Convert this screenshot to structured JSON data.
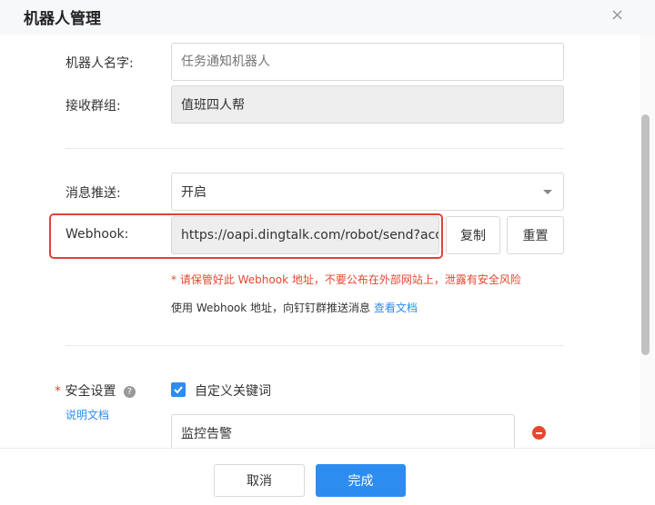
{
  "dialog": {
    "title": "机器人管理",
    "close_icon": "×"
  },
  "form": {
    "robot_name": {
      "label": "机器人名字:",
      "placeholder": "任务通知机器人"
    },
    "receive_group": {
      "label": "接收群组:",
      "value": "值班四人帮"
    },
    "message_push": {
      "label": "消息推送:",
      "value": "开启"
    },
    "webhook": {
      "label": "Webhook:",
      "value": "https://oapi.dingtalk.com/robot/send?access_token=",
      "copy_label": "复制",
      "reset_label": "重置",
      "warning": "* 请保管好此 Webhook 地址，不要公布在外部网站上，泄露有安全风险",
      "hint": "使用 Webhook 地址，向钉钉群推送消息",
      "doc_link": "查看文档"
    },
    "security": {
      "required_mark": "*",
      "label": "安全设置",
      "help_icon": "?",
      "doc_link": "说明文档",
      "checkbox_label": "自定义关键词",
      "checkbox_checked": true,
      "keyword_value": "监控告警"
    }
  },
  "footer": {
    "cancel_label": "取消",
    "done_label": "完成"
  },
  "colors": {
    "primary": "#2d8cf0",
    "warning": "#e5482f",
    "highlight_border": "#d9453c"
  }
}
